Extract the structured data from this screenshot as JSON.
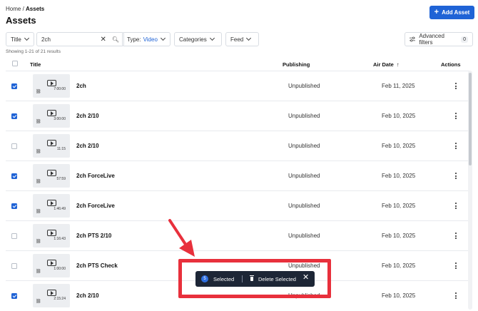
{
  "breadcrumb": {
    "home": "Home",
    "separator": " / ",
    "current": "Assets"
  },
  "page_title": "Assets",
  "add_button": "Add Asset",
  "filters": {
    "title_label": "Title",
    "search_value": "2ch",
    "type_label": "Type:",
    "type_value": "Video",
    "categories_label": "Categories",
    "feed_label": "Feed",
    "advanced_label": "Advanced filters",
    "advanced_count": "0"
  },
  "showing": "Showing 1-21 of 21 results",
  "columns": {
    "title": "Title",
    "publishing": "Publishing",
    "air_date": "Air Date",
    "actions": "Actions"
  },
  "rows": [
    {
      "title": "2ch",
      "duration": "7:00:00",
      "publishing": "Unpublished",
      "air_date": "Feb 11, 2025",
      "checked": true
    },
    {
      "title": "2ch 2/10",
      "duration": "3:00:00",
      "publishing": "Unpublished",
      "air_date": "Feb 10, 2025",
      "checked": true
    },
    {
      "title": "2ch 2/10",
      "duration": "11:15",
      "publishing": "Unpublished",
      "air_date": "Feb 10, 2025",
      "checked": false
    },
    {
      "title": "2ch ForceLive",
      "duration": "57:59",
      "publishing": "Unpublished",
      "air_date": "Feb 10, 2025",
      "checked": true
    },
    {
      "title": "2ch ForceLive",
      "duration": "1:46:49",
      "publishing": "Unpublished",
      "air_date": "Feb 10, 2025",
      "checked": true
    },
    {
      "title": "2ch PTS 2/10",
      "duration": "1:16:43",
      "publishing": "Unpublished",
      "air_date": "Feb 10, 2025",
      "checked": false
    },
    {
      "title": "2ch PTS Check",
      "duration": "1:00:00",
      "publishing": "Unpublished",
      "air_date": "Feb 10, 2025",
      "checked": false
    },
    {
      "title": "2ch 2/10",
      "duration": "2:15:24",
      "publishing": "Unpublished",
      "air_date": "Feb 10, 2025",
      "checked": true
    }
  ],
  "selection_bar": {
    "count": "5",
    "selected_label": "Selected",
    "delete_label": "Delete Selected"
  },
  "colors": {
    "accent": "#1f63d6",
    "annotation": "#e8303c",
    "selection_bar": "#1d2636"
  }
}
